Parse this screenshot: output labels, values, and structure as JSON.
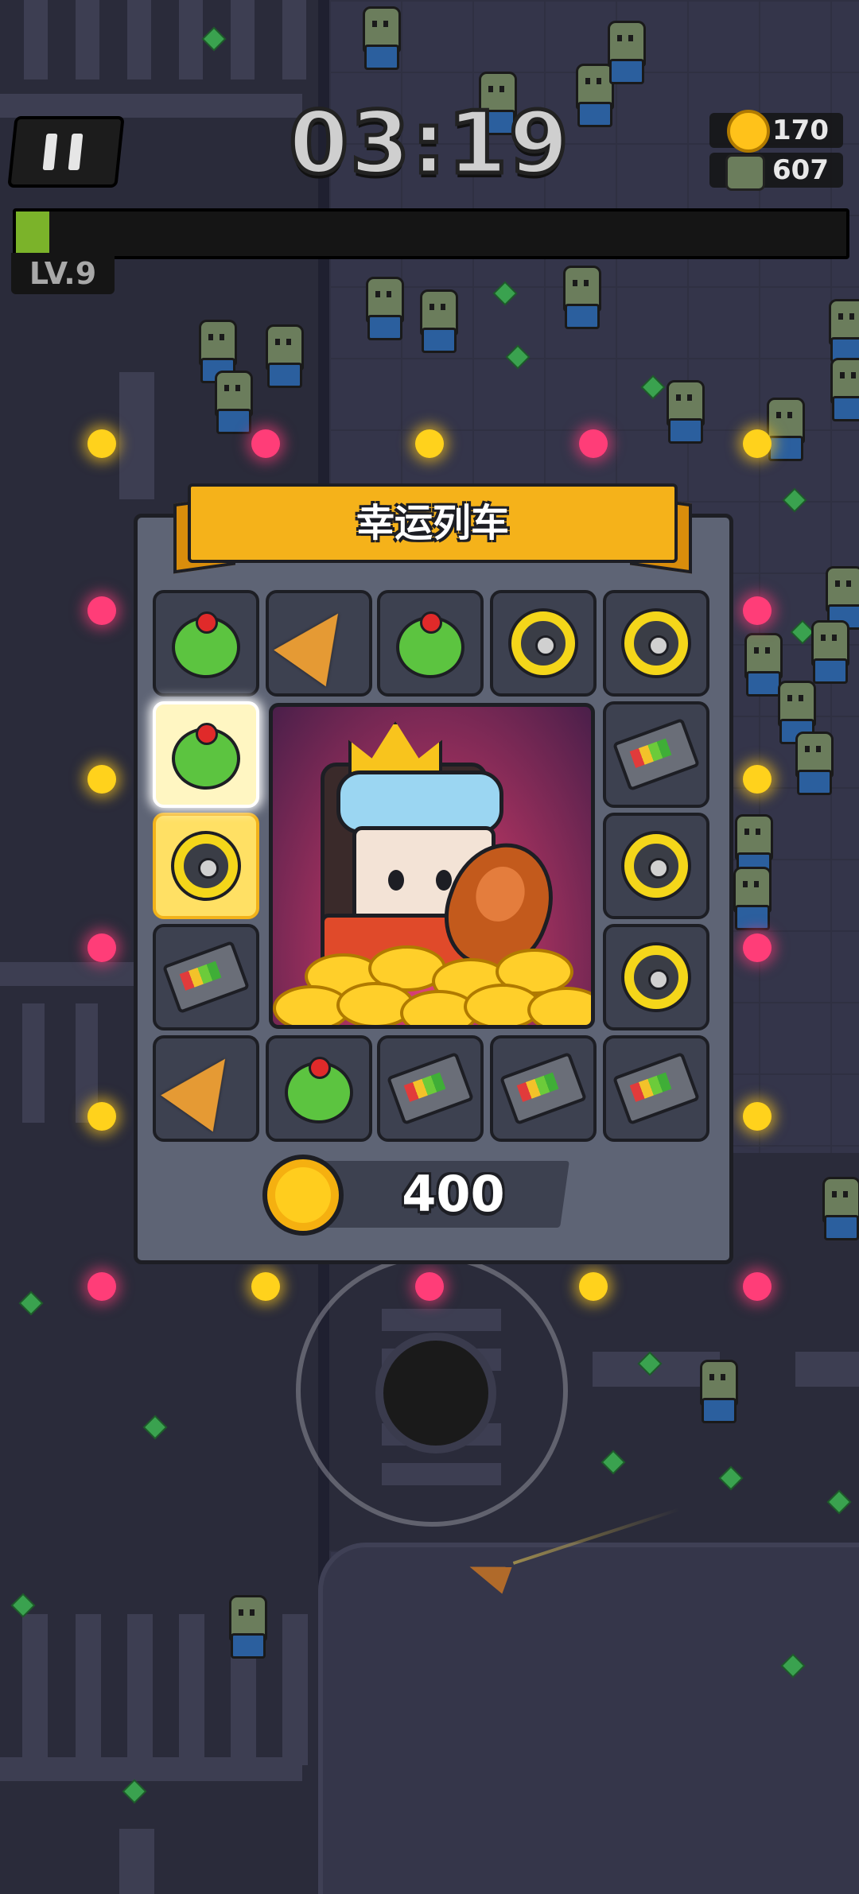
{
  "hud": {
    "timer": "03:19",
    "coins": "170",
    "kills": "607",
    "level": "LV.9",
    "xp_fraction": 0.04
  },
  "popup": {
    "title": "幸运列车",
    "price": "400"
  },
  "slots": [
    {
      "item": "green-orb-icon",
      "state": "normal"
    },
    {
      "item": "drill-icon",
      "state": "normal"
    },
    {
      "item": "green-orb-icon",
      "state": "normal"
    },
    {
      "item": "shuriken-ring-icon",
      "state": "normal"
    },
    {
      "item": "shuriken-ring-icon",
      "state": "normal"
    },
    {
      "item": "battery-icon",
      "state": "normal"
    },
    {
      "item": "shuriken-ring-icon",
      "state": "normal"
    },
    {
      "item": "shuriken-ring-icon",
      "state": "normal"
    },
    {
      "item": "battery-icon",
      "state": "normal"
    },
    {
      "item": "battery-icon",
      "state": "normal"
    },
    {
      "item": "battery-icon",
      "state": "normal"
    },
    {
      "item": "green-orb-icon",
      "state": "normal"
    },
    {
      "item": "drill-icon",
      "state": "normal"
    },
    {
      "item": "battery-icon",
      "state": "normal"
    },
    {
      "item": "shuriken-ring-icon",
      "state": "selected"
    },
    {
      "item": "green-orb-icon",
      "state": "highlighted"
    }
  ],
  "colors": {
    "panel": "#5e6475",
    "ribbon": "#f5b21a",
    "xp": "#7bb32a",
    "glow_yellow": "#ffd21c",
    "glow_pink": "#ff3d78"
  }
}
